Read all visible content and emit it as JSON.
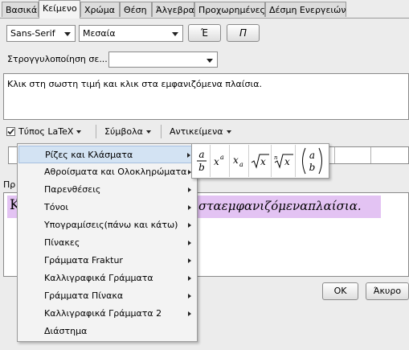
{
  "tabs": [
    "Βασικά",
    "Κείμενο",
    "Χρώμα",
    "Θέση",
    "Άλγεβρα",
    "Προχωρημένες",
    "Δέσμη Ενεργειών"
  ],
  "toolbar": {
    "font_family": "Sans-Serif",
    "font_size": "Μεσαία",
    "bold_label": "Έ",
    "italic_label": "Π"
  },
  "rounding": {
    "label": "Στρογγυλοποίηση σε...:",
    "value": ""
  },
  "editor_text": "Κλικ στη σωστη τιμή  και κλικ στα εμφανιζόμενα πλαίσια.",
  "latex": {
    "checkbox_label": "Τύπος LaTeX",
    "checked": true
  },
  "symbols_label": "Σύμβολα",
  "objects_label": "Αντικείμενα",
  "preview": {
    "label": "Πρ",
    "first_char": "Κ",
    "text": "σταεμφανιζόμεναπλαίσια."
  },
  "menu_items": [
    "Ρίζες και Κλάσματα",
    "Αθροίσματα και Ολοκληρώματα",
    "Παρενθέσεις",
    "Τόνοι",
    "Υπογραμίσεις(πάνω και κάτω)",
    "Πίνακες",
    "Γράμματα Fraktur",
    "Καλλιγραφικά Γράμματα",
    "Γράμματα Πίνακα",
    "Καλλιγραφικά Γράμματα 2",
    "Διάστημα"
  ],
  "submenu_symbols": [
    "fraction-a-over-b",
    "x-superscript-a",
    "x-subscript-a",
    "square-root-x",
    "nth-root-x",
    "binomial-a-b"
  ],
  "dialog": {
    "ok_label": "OK",
    "cancel_label": "Άκυρο"
  },
  "colors": {
    "preview_highlight": "#e3c3f3",
    "menu_highlight": "#d3e3f3"
  }
}
